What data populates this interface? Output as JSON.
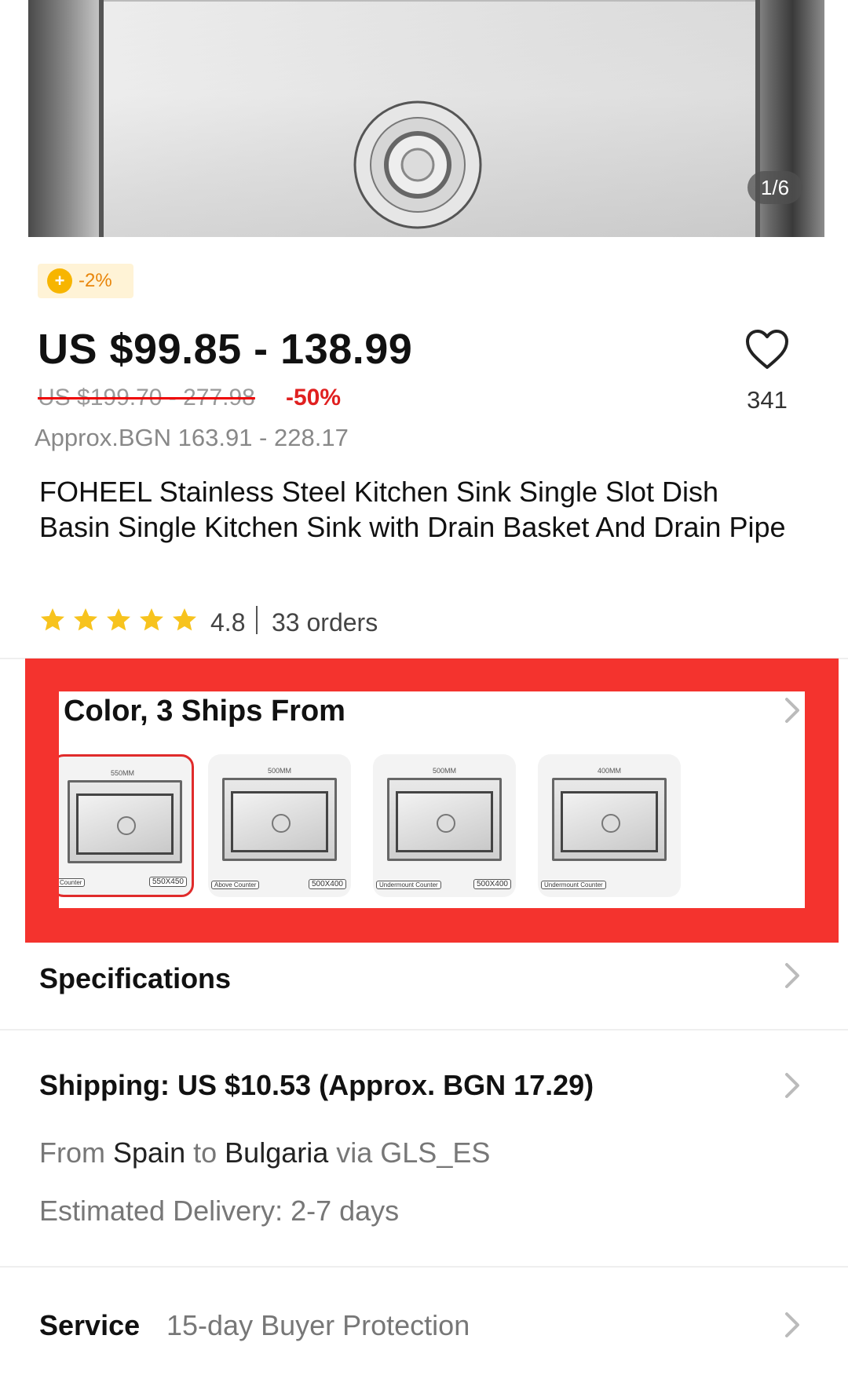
{
  "gallery": {
    "counter": "1/6"
  },
  "coin_badge": {
    "icon": "coin-icon",
    "text": "-2%"
  },
  "price": {
    "current": "US $99.85 - 138.99",
    "original": "US $199.70 - 277.98",
    "discount": "-50%",
    "approx": "Approx.BGN 163.91 - 228.17"
  },
  "wishlist": {
    "icon": "heart-icon",
    "count": "341"
  },
  "product": {
    "title": "FOHEEL Stainless Steel Kitchen Sink Single Slot Dish Basin Single Kitchen Sink with Drain Basket And Drain Pipe"
  },
  "rating": {
    "stars": 5,
    "value": "4.8",
    "orders": "33 orders"
  },
  "variation": {
    "title": "Color, 3 Ships From",
    "highlight_color": "#f4332e",
    "options": [
      {
        "top": "550MM",
        "left": "Counter",
        "right": "550X450",
        "selected": true
      },
      {
        "top": "500MM",
        "left": "Above Counter",
        "right": "500X400",
        "selected": false
      },
      {
        "top": "500MM",
        "left": "Undermount Counter",
        "right": "500X400",
        "selected": false
      },
      {
        "top": "400MM",
        "left": "Undermount Counter",
        "right": "",
        "selected": false
      }
    ]
  },
  "specifications": {
    "title": "Specifications"
  },
  "shipping": {
    "title": "Shipping: US $10.53 (Approx. BGN 17.29)",
    "from_label": "From",
    "from": "Spain",
    "to_label": "to",
    "to": "Bulgaria",
    "via": "via GLS_ES",
    "estimated": "Estimated Delivery: 2-7 days"
  },
  "service": {
    "title": "Service",
    "text": "15-day Buyer Protection"
  },
  "colors": {
    "price_red": "#e02020",
    "star": "#f7c31e",
    "coin": "#f7b500"
  }
}
